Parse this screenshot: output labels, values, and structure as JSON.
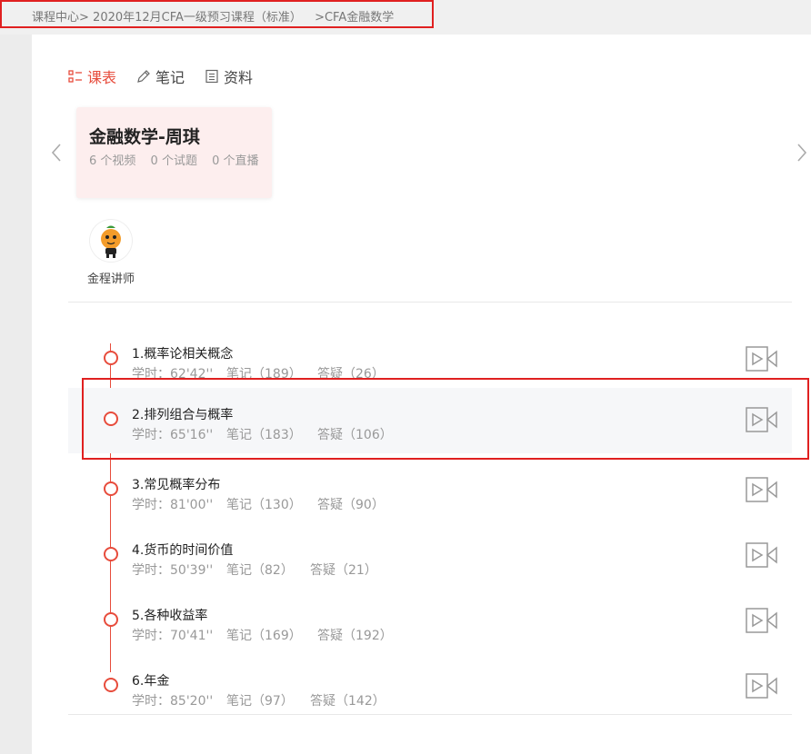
{
  "breadcrumb": {
    "home": "课程中心>",
    "course": "2020年12月CFA一级预习课程（标准）",
    "current": ">CFA金融数学"
  },
  "tabs": [
    {
      "label": "课表",
      "icon": "list-icon",
      "active": true
    },
    {
      "label": "笔记",
      "icon": "pencil-icon",
      "active": false
    },
    {
      "label": "资料",
      "icon": "document-icon",
      "active": false
    }
  ],
  "course_card": {
    "title": "金融数学-周琪",
    "videos": "6 个视频",
    "quizzes": "0 个试题",
    "lives": "0 个直播"
  },
  "teacher": {
    "name": "金程讲师",
    "icon": "orange-mascot-avatar"
  },
  "lessons": [
    {
      "title": "1.概率论相关概念",
      "hours": "学时：62'42''",
      "notes": "笔记（189）",
      "qa": "答疑（26）"
    },
    {
      "title": "2.排列组合与概率",
      "hours": "学时：65'16''",
      "notes": "笔记（183）",
      "qa": "答疑（106）"
    },
    {
      "title": "3.常见概率分布",
      "hours": "学时：81'00''",
      "notes": "笔记（130）",
      "qa": "答疑（90）"
    },
    {
      "title": "4.货币的时间价值",
      "hours": "学时：50'39''",
      "notes": "笔记（82）",
      "qa": "答疑（21）"
    },
    {
      "title": "5.各种收益率",
      "hours": "学时：70'41''",
      "notes": "笔记（169）",
      "qa": "答疑（192）"
    },
    {
      "title": "6.年金",
      "hours": "学时：85'20''",
      "notes": "笔记（97）",
      "qa": "答疑（142）"
    }
  ],
  "colors": {
    "accent": "#e74c3c",
    "card_bg": "#fdeeee",
    "highlight_border": "#e02020"
  }
}
